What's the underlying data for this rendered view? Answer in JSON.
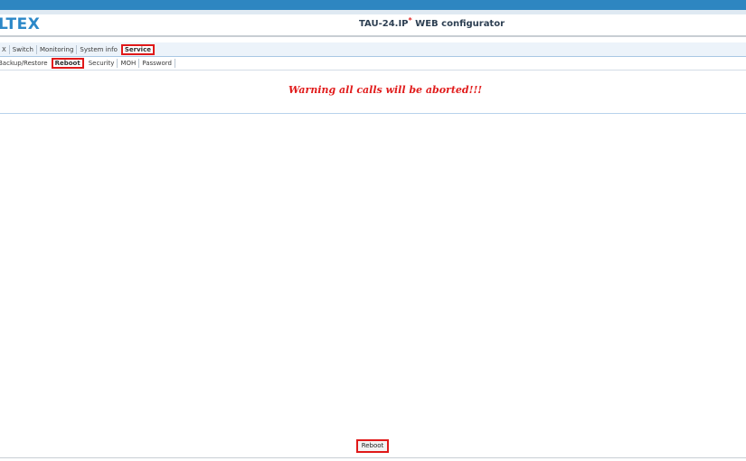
{
  "header": {
    "logo_text": "LTEX",
    "title_main": "TAU-24.IP",
    "title_sup": "*",
    "title_rest": " WEB configurator"
  },
  "main_nav": {
    "items": [
      "X",
      "Switch",
      "Monitoring",
      "System info"
    ],
    "active_label": "Service"
  },
  "sub_nav": {
    "first_label": "Backup/Restore",
    "active_label": "Reboot",
    "items": [
      "Security",
      "MOH",
      "Password"
    ]
  },
  "content": {
    "warning": "Warning all calls will be aborted!!!"
  },
  "actions": {
    "reboot_label": "Reboot"
  },
  "colors": {
    "brand_blue": "#2e86c1",
    "highlight_red": "#e01919",
    "warning_red": "#e11c1c"
  }
}
